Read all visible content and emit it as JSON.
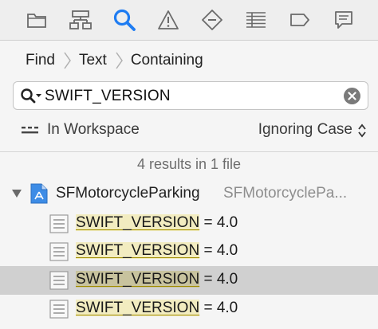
{
  "toolbar": {
    "icons": [
      {
        "name": "folder-icon"
      },
      {
        "name": "hierarchy-icon"
      },
      {
        "name": "search-icon",
        "active": true
      },
      {
        "name": "warning-icon"
      },
      {
        "name": "breakpoint-diamond-icon"
      },
      {
        "name": "list-icon"
      },
      {
        "name": "tag-icon"
      },
      {
        "name": "comment-icon"
      }
    ],
    "active_color": "#1e7cf2",
    "inactive_color": "#6a6a6a"
  },
  "breadcrumb": [
    "Find",
    "Text",
    "Containing"
  ],
  "search": {
    "value": "SWIFT_VERSION"
  },
  "scope": {
    "label": "In Workspace",
    "case": "Ignoring Case"
  },
  "summary": "4 results in 1 file",
  "file": {
    "name": "SFMotorcycleParking",
    "path": "SFMotorcyclePa..."
  },
  "results": [
    {
      "match": "SWIFT_VERSION",
      "rest": " = 4.0",
      "selected": false
    },
    {
      "match": "SWIFT_VERSION",
      "rest": " = 4.0",
      "selected": false
    },
    {
      "match": "SWIFT_VERSION",
      "rest": " = 4.0",
      "selected": true
    },
    {
      "match": "SWIFT_VERSION",
      "rest": " = 4.0",
      "selected": false
    }
  ]
}
